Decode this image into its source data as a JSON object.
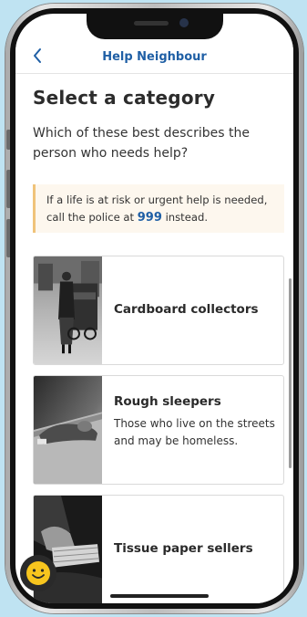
{
  "nav": {
    "back_icon": "chevron-left-icon",
    "title": "Help Neighbour"
  },
  "page": {
    "heading": "Select a category",
    "subtitle": "Which of these best describes the person who needs help?",
    "notice": {
      "before": "If a life is at risk or urgent help is needed, call the police at ",
      "number": "999",
      "after": " instead."
    }
  },
  "categories": [
    {
      "name": "Cardboard collectors",
      "description": ""
    },
    {
      "name": "Rough sleepers",
      "description": "Those who live on the streets and may be homeless."
    },
    {
      "name": "Tissue paper sellers",
      "description": ""
    }
  ],
  "feedback": {
    "icon": "smiley-face-icon",
    "color": "#f7c51e"
  },
  "colors": {
    "accent": "#1f5fa5",
    "notice_border": "#f0c37a",
    "notice_bg": "#fdf7ee"
  }
}
